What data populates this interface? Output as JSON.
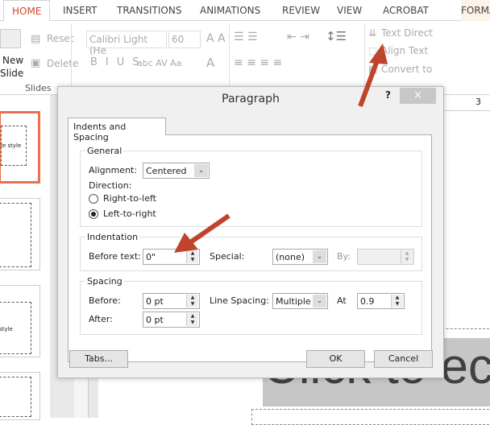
{
  "ribbon_tabs": [
    {
      "label": "HOME",
      "active": true
    },
    {
      "label": "INSERT"
    },
    {
      "label": "TRANSITIONS"
    },
    {
      "label": "ANIMATIONS"
    },
    {
      "label": "REVIEW"
    },
    {
      "label": "VIEW"
    },
    {
      "label": "ACROBAT"
    },
    {
      "label": "FORMA"
    }
  ],
  "ribbon": {
    "new_slide": "New",
    "new_slide2": "Slide",
    "reset": "Reset",
    "delete": "Delete",
    "slides_group": "Slides",
    "font_name": "Calibri Light (He",
    "font_size": "60",
    "text_direction": "Text Direct",
    "align_text": "Align Text",
    "convert_to": "Convert to",
    "ruler_mark": "3"
  },
  "slide": {
    "placeholder_text": "Click to ec",
    "thumb_text": "le style",
    "thumb_text2": "style"
  },
  "dialog": {
    "title": "Paragraph",
    "help": "?",
    "close": "×",
    "tab": "Indents and Spacing",
    "general": {
      "title": "General",
      "alignment_label": "Alignment:",
      "alignment_value": "Centered",
      "direction_label": "Direction:",
      "rtl": "Right-to-left",
      "ltr": "Left-to-right",
      "selected": "ltr"
    },
    "indentation": {
      "title": "Indentation",
      "before_text_label": "Before text:",
      "before_text_value": "0\"",
      "special_label": "Special:",
      "special_value": "(none)",
      "by_label": "By:",
      "by_value": ""
    },
    "spacing": {
      "title": "Spacing",
      "before_label": "Before:",
      "before_value": "0 pt",
      "after_label": "After:",
      "after_value": "0 pt",
      "line_spacing_label": "Line Spacing:",
      "line_spacing_value": "Multiple",
      "at_label": "At",
      "at_value": "0.9"
    },
    "tabs_button": "Tabs...",
    "ok": "OK",
    "cancel": "Cancel"
  },
  "colors": {
    "accent": "#d24726",
    "arrow": "#c0432c",
    "selected_thumb": "#e8704f"
  }
}
